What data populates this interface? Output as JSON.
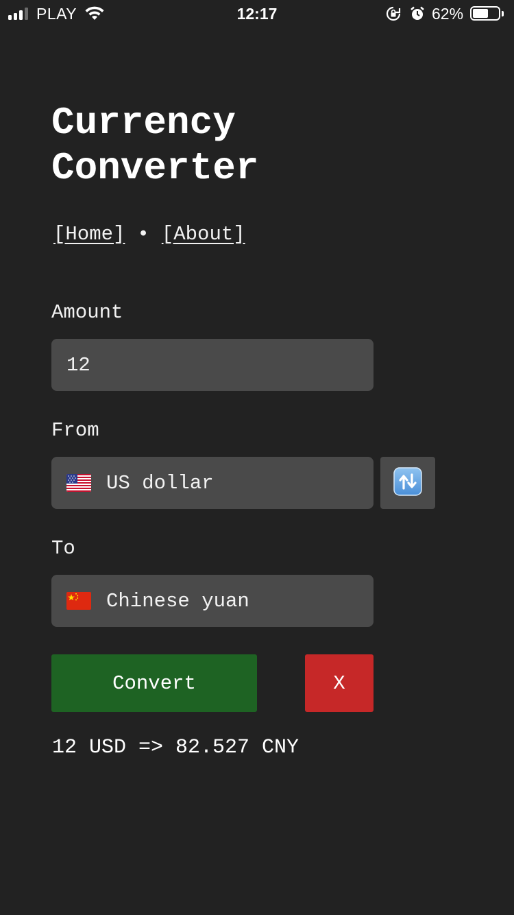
{
  "status_bar": {
    "carrier": "PLAY",
    "time": "12:17",
    "battery_percent": "62%",
    "battery_level": 0.62
  },
  "header": {
    "title_line1": "Currency",
    "title_line2": "Converter"
  },
  "nav": {
    "home_label": "[Home]",
    "separator": "•",
    "about_label": "[About]"
  },
  "form": {
    "amount_label": "Amount",
    "amount_value": "12",
    "from_label": "From",
    "from_currency": "US dollar",
    "from_flag": "us-flag-icon",
    "swap_icon": "swap-arrows-icon",
    "to_label": "To",
    "to_currency": "Chinese yuan",
    "to_flag": "cn-flag-icon",
    "convert_label": "Convert",
    "clear_label": "X"
  },
  "result": {
    "text": "12 USD => 82.527 CNY"
  },
  "colors": {
    "background": "#222222",
    "field": "#4a4a4a",
    "convert": "#1e6323",
    "clear": "#c62828"
  }
}
